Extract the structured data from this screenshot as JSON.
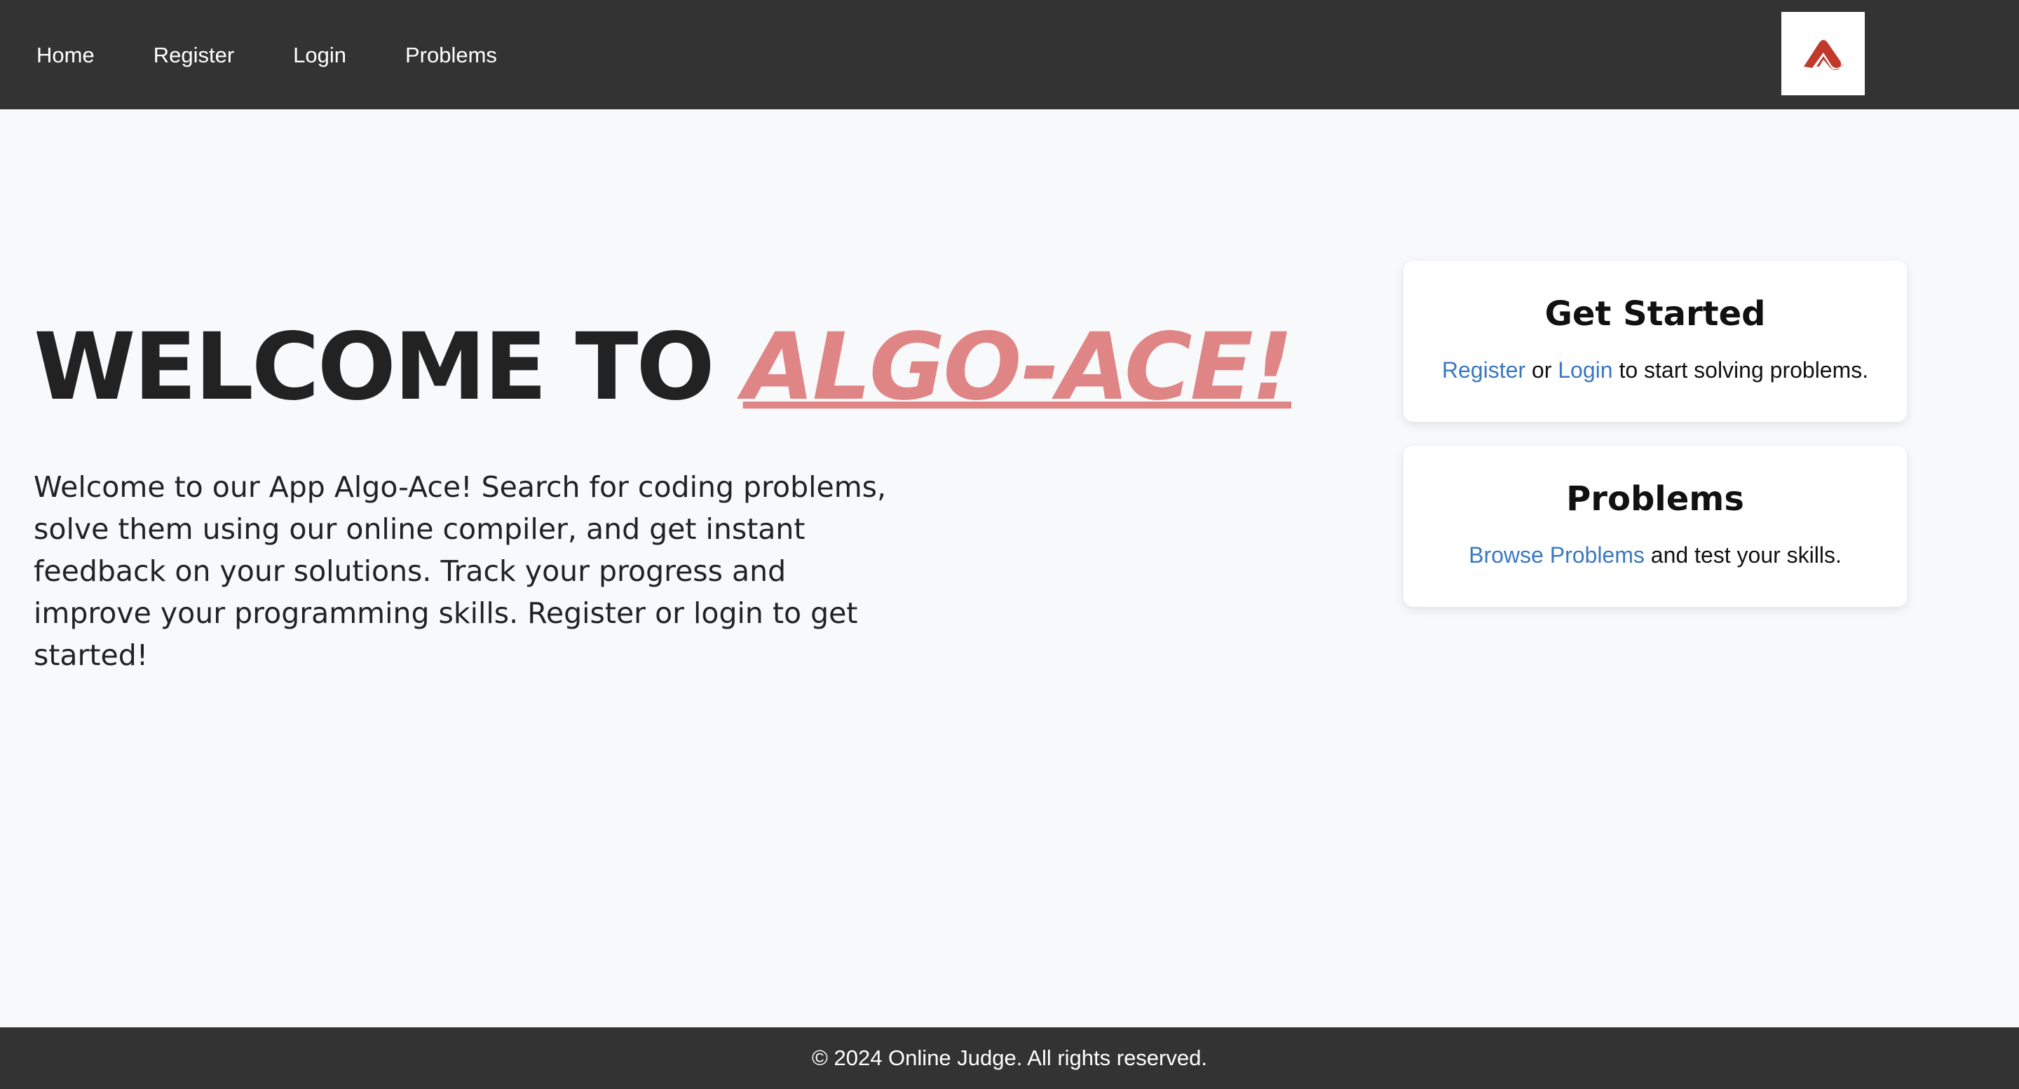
{
  "nav": {
    "links": [
      "Home",
      "Register",
      "Login",
      "Problems"
    ],
    "logo_icon": "algo-ace-logo-icon"
  },
  "hero": {
    "title_prefix": "WELCOME TO ",
    "title_brand": "ALGO-ACE!",
    "description": "Welcome to our App Algo-Ace! Search for coding problems, solve them using our online compiler, and get instant feedback on your solutions. Track your progress and improve your programming skills. Register or login to get started!"
  },
  "cards": {
    "get_started": {
      "title": "Get Started",
      "register_link": "Register",
      "or_text": " or ",
      "login_link": "Login",
      "suffix": " to start solving problems."
    },
    "problems": {
      "title": "Problems",
      "browse_link": "Browse Problems",
      "suffix": " and test your skills."
    }
  },
  "footer": {
    "text": "© 2024 Online Judge. All rights reserved."
  },
  "colors": {
    "header_bg": "#333333",
    "page_bg": "#f8f9fb",
    "brand": "#e08585",
    "link": "#3a78c0",
    "logo": "#c0392b"
  }
}
